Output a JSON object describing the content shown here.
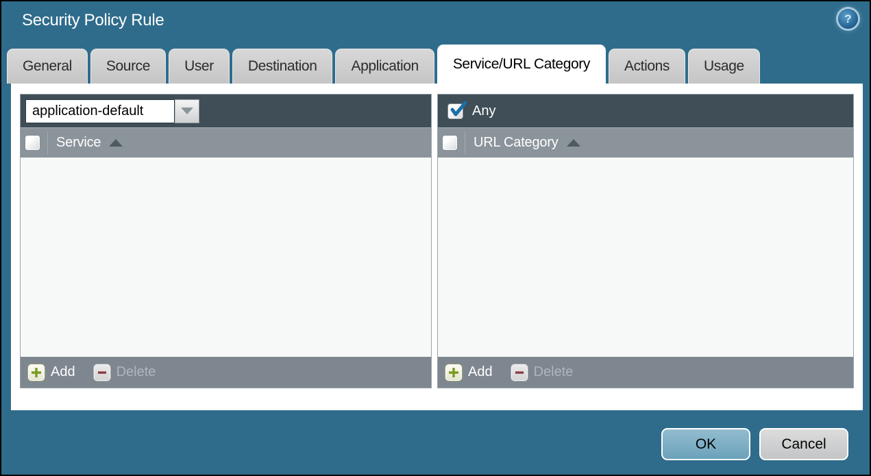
{
  "window": {
    "title": "Security Policy Rule"
  },
  "tabs": [
    {
      "label": "General",
      "active": false
    },
    {
      "label": "Source",
      "active": false
    },
    {
      "label": "User",
      "active": false
    },
    {
      "label": "Destination",
      "active": false
    },
    {
      "label": "Application",
      "active": false
    },
    {
      "label": "Service/URL Category",
      "active": true
    },
    {
      "label": "Actions",
      "active": false
    },
    {
      "label": "Usage",
      "active": false
    }
  ],
  "service_panel": {
    "dropdown_value": "application-default",
    "column_header": "Service",
    "add_label": "Add",
    "delete_label": "Delete",
    "delete_enabled": false,
    "rows": []
  },
  "url_category_panel": {
    "any_label": "Any",
    "any_checked": true,
    "column_header": "URL Category",
    "add_label": "Add",
    "delete_label": "Delete",
    "delete_enabled": false,
    "rows": []
  },
  "dialog_buttons": {
    "ok": "OK",
    "cancel": "Cancel"
  },
  "icons": {
    "help": "help-icon",
    "dropdown": "chevron-down-icon",
    "sort": "sort-ascending-icon",
    "add": "plus-icon",
    "delete": "minus-icon",
    "checked": "checkmark-icon"
  },
  "colors": {
    "background": "#2f6c8c",
    "panel_header": "#3f4e57",
    "column_header": "#8b949b",
    "panel_footer": "#7e8790",
    "panel_body": "#f7f8f8",
    "ok_button": "#76a7be",
    "cancel_button": "#cccccc",
    "checkmark": "#1c6fa8",
    "add_plus": "#7c9b1e",
    "delete_minus": "#8a3b3f"
  }
}
